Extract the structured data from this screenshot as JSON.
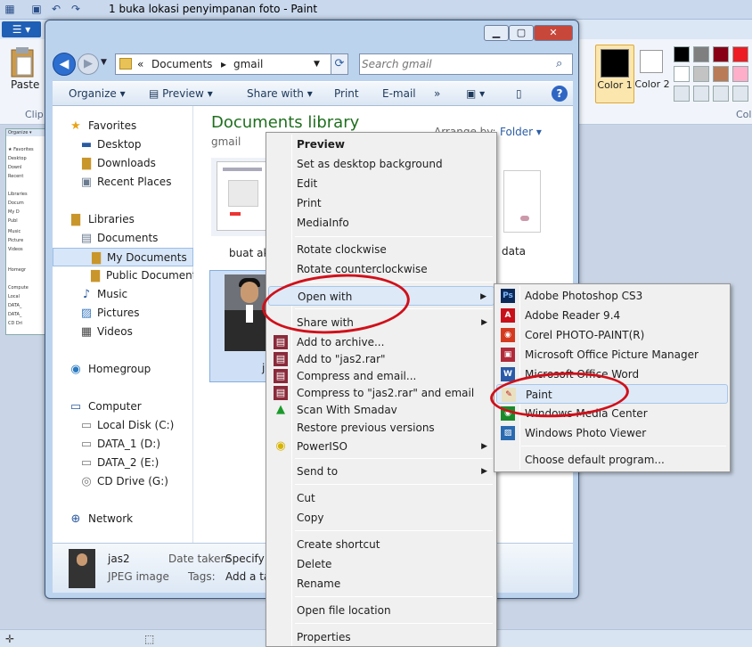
{
  "paint": {
    "title": "1 buka lokasi penyimpanan foto - Paint",
    "paste_label": "Paste",
    "clipboard_label": "Clip",
    "color1_label": "Color 1",
    "color2_label": "Color 2",
    "colors_group_label": "Colo",
    "palette": [
      "#000000",
      "#7f7f7f",
      "#880015",
      "#ed1c24",
      "#ffffff",
      "#c3c3c3",
      "#b97a57",
      "#ffaec9",
      "#dfe6ee",
      "#dfe6ee",
      "#dfe6ee",
      "#dfe6ee"
    ]
  },
  "explorer": {
    "address": {
      "sep": "«",
      "segments": [
        "Documents",
        "gmail"
      ]
    },
    "search": {
      "placeholder": "Search gmail"
    },
    "commands": [
      "Organize",
      "Preview",
      "Share with",
      "Print",
      "E-mail",
      "»"
    ],
    "nav": {
      "favorites": "Favorites",
      "desktop": "Desktop",
      "downloads": "Downloads",
      "recent": "Recent Places",
      "libraries": "Libraries",
      "documents": "Documents",
      "my_documents": "My Documents",
      "public_documents": "Public Documents",
      "music": "Music",
      "pictures": "Pictures",
      "videos": "Videos",
      "homegroup": "Homegroup",
      "computer": "Computer",
      "local_disk": "Local Disk (C:)",
      "data1": "DATA_1 (D:)",
      "data2": "DATA_2 (E:)",
      "cd_drive": "CD Drive (G:)",
      "network": "Network"
    },
    "content": {
      "title": "Documents library",
      "subtitle": "gmail",
      "arrange_label": "Arrange by:",
      "arrange_value": "Folder ▾",
      "files": [
        "buat ak",
        "jas2",
        "data"
      ]
    },
    "details": {
      "name": "jas2",
      "type": "JPEG image",
      "date_label": "Date taken:",
      "date_value": "Specify d",
      "tags_label": "Tags:",
      "tags_value": "Add a ta"
    }
  },
  "context_menu": [
    "Preview",
    "Set as desktop background",
    "Edit",
    "Print",
    "MediaInfo",
    "Rotate clockwise",
    "Rotate counterclockwise",
    "Open with",
    "Share with",
    "Add to archive...",
    "Add to \"jas2.rar\"",
    "Compress and email...",
    "Compress to \"jas2.rar\" and email",
    "Scan With Smadav",
    "Restore previous versions",
    "PowerISO",
    "Send to",
    "Cut",
    "Copy",
    "Create shortcut",
    "Delete",
    "Rename",
    "Open file location",
    "Properties"
  ],
  "open_with_menu": [
    "Adobe Photoshop CS3",
    "Adobe Reader 9.4",
    "Corel PHOTO-PAINT(R)",
    "Microsoft Office Picture Manager",
    "Microsoft Office Word",
    "Paint",
    "Windows Media Center",
    "Windows Photo Viewer",
    "Choose default program..."
  ],
  "highlight_color": "#d0101a"
}
